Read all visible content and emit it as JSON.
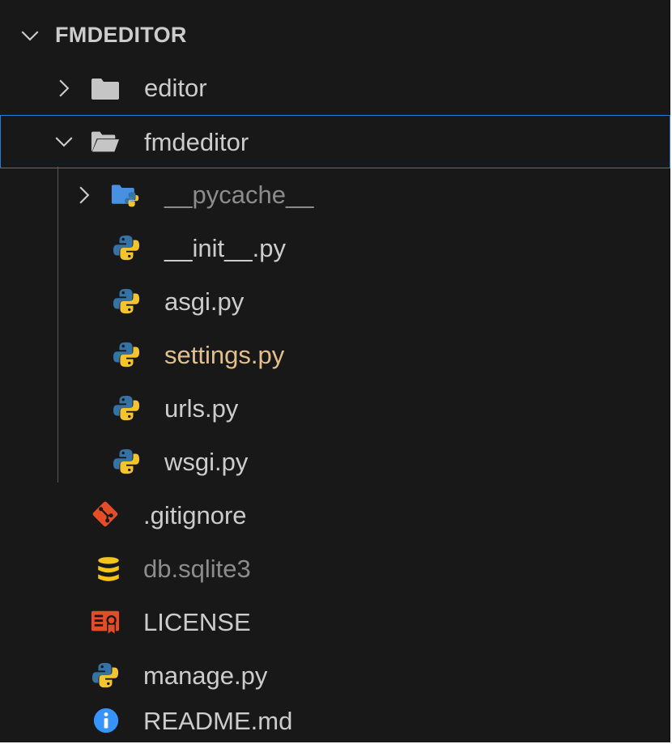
{
  "explorer": {
    "section_title": "FMDEDITOR",
    "items": [
      {
        "label": "editor",
        "kind": "folder",
        "color": "#cccccc"
      },
      {
        "label": "fmdeditor",
        "kind": "folder-open",
        "color": "#cccccc",
        "selected": true
      },
      {
        "label": "__pycache__",
        "kind": "python-folder",
        "color": "#8c8c8c"
      },
      {
        "label": "__init__.py",
        "kind": "python",
        "color": "#cccccc"
      },
      {
        "label": "asgi.py",
        "kind": "python",
        "color": "#cccccc"
      },
      {
        "label": "settings.py",
        "kind": "python",
        "color": "#e2c08d"
      },
      {
        "label": "urls.py",
        "kind": "python",
        "color": "#cccccc"
      },
      {
        "label": "wsgi.py",
        "kind": "python",
        "color": "#cccccc"
      },
      {
        "label": ".gitignore",
        "kind": "git",
        "color": "#cccccc"
      },
      {
        "label": "db.sqlite3",
        "kind": "database",
        "color": "#8c8c8c"
      },
      {
        "label": "LICENSE",
        "kind": "license",
        "color": "#cccccc"
      },
      {
        "label": "manage.py",
        "kind": "python",
        "color": "#cccccc"
      },
      {
        "label": "README.md",
        "kind": "info",
        "color": "#cccccc"
      }
    ]
  },
  "colors": {
    "background": "#181818",
    "text": "#cccccc",
    "dimmed_text": "#8c8c8c",
    "modified_text": "#e2c08d",
    "selection_border": "#2b79d2",
    "python_blue": "#3572a5",
    "python_yellow": "#f4c430",
    "git_orange": "#e44d26",
    "db_yellow": "#f3c419",
    "license_red": "#e44d26",
    "info_blue": "#3794ff"
  }
}
